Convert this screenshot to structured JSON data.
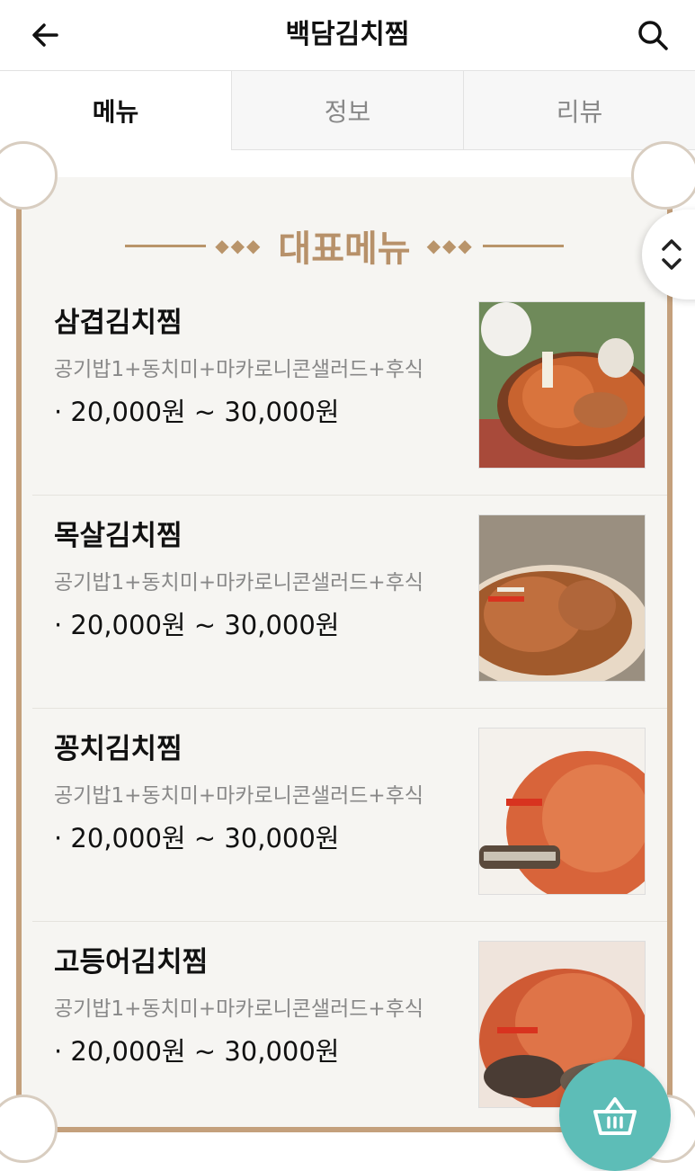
{
  "header": {
    "title": "백담김치찜",
    "back_icon": "arrow-left-icon",
    "search_icon": "search-icon"
  },
  "tabs": [
    {
      "label": "메뉴",
      "active": true
    },
    {
      "label": "정보",
      "active": false
    },
    {
      "label": "리뷰",
      "active": false
    }
  ],
  "section": {
    "title": "대표메뉴",
    "accent_color": "#b7916a"
  },
  "menu": [
    {
      "name": "삼겹김치찜",
      "desc": "공기밥1+동치미+마카로니콘샐러드+후식",
      "price": "· 20,000원 ~ 30,000원"
    },
    {
      "name": "목살김치찜",
      "desc": "공기밥1+동치미+마카로니콘샐러드+후식",
      "price": "· 20,000원 ~ 30,000원"
    },
    {
      "name": "꽁치김치찜",
      "desc": "공기밥1+동치미+마카로니콘샐러드+후식",
      "price": "· 20,000원 ~ 30,000원"
    },
    {
      "name": "고등어김치찜",
      "desc": "공기밥1+동치미+마카로니콘샐러드+후식",
      "price": "· 20,000원 ~ 30,000원"
    }
  ],
  "floating": {
    "scroll_icon": "chevron-up-down-icon",
    "cart_icon": "basket-icon",
    "cart_color": "#5dbdb7"
  }
}
